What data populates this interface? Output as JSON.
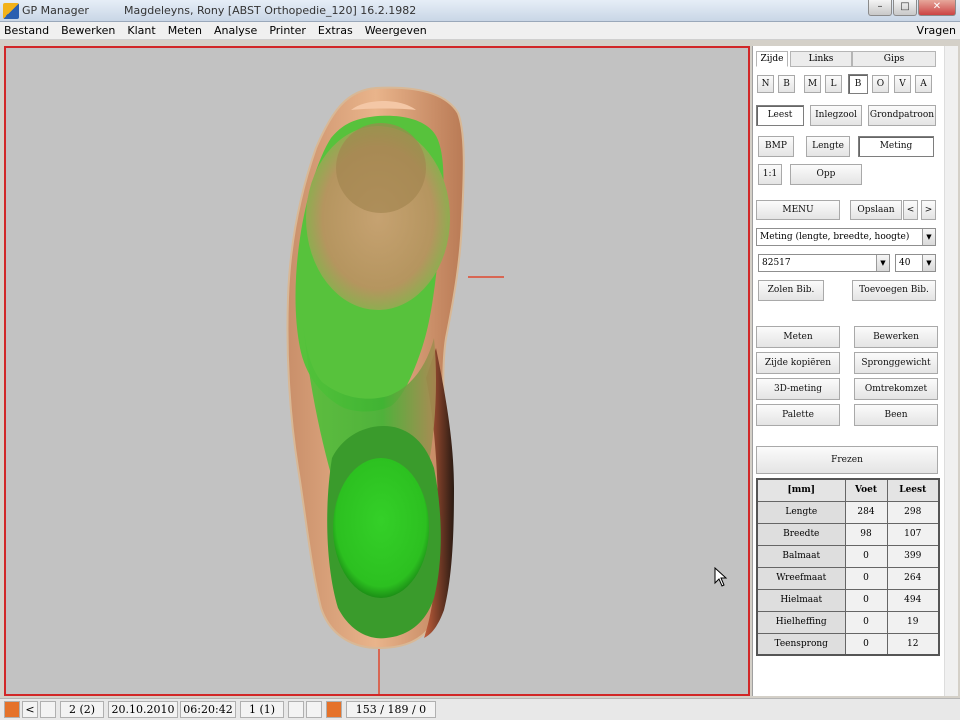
{
  "window": {
    "app_title": "GP Manager",
    "document_title": "Magdeleyns, Rony   [ABST Orthopedie_120]   16.2.1982",
    "buttons": [
      "–",
      "□",
      "✕"
    ]
  },
  "menu": {
    "items": [
      "Bestand",
      "Bewerken",
      "Klant",
      "Meten",
      "Analyse",
      "Printer",
      "Extras",
      "Weergeven"
    ],
    "help": "Vragen"
  },
  "panel": {
    "side_tabs": [
      "Zijde",
      "Links",
      "Gips"
    ],
    "view_buttons": [
      "N",
      "B",
      "M",
      "L",
      "B",
      "O",
      "V",
      "A"
    ],
    "active_view_index": 4,
    "mode_buttons": [
      "Leest",
      "Inlegzool",
      "Grondpatroon"
    ],
    "active_mode_index": 0,
    "tool_row1": [
      "BMP",
      "Lengte",
      "Meting"
    ],
    "tool_row2": [
      "1:1",
      "Opp"
    ],
    "menu_button": "MENU",
    "save_button": "Opslaan",
    "prev_arrow": "<",
    "next_arrow": ">",
    "measure_select": "Meting (lengte, breedte, hoogte)",
    "code_select": "82517",
    "size_select": "40",
    "zoom_buttons": [
      "Zolen Bib.",
      "Toevoegen Bib."
    ],
    "action_buttons": [
      "Meten",
      "Bewerken",
      "Zijde kopiëren",
      "Spronggewicht",
      "3D-meting",
      "Omtrekomzet",
      "Palette",
      "Been"
    ],
    "mill_button": "Frezen"
  },
  "measure_table": {
    "headers": [
      "[mm]",
      "Voet",
      "Leest"
    ],
    "rows": [
      [
        "Lengte",
        "284",
        "298"
      ],
      [
        "Breedte",
        "98",
        "107"
      ],
      [
        "Balmaat",
        "0",
        "399"
      ],
      [
        "Wreefmaat",
        "0",
        "264"
      ],
      [
        "Hielmaat",
        "0",
        "494"
      ],
      [
        "Hielheffing",
        "0",
        "19"
      ],
      [
        "Teensprong",
        "0",
        "12"
      ]
    ]
  },
  "status": {
    "page": "2 (2)",
    "date": "20.10.2010",
    "time": "06:20:42",
    "count": "1 (1)",
    "info": "153 / 189 / 0"
  },
  "colors": {
    "viewport_border": "#d12727",
    "viewport_bg": "#c2c2c2",
    "crosshair": "#e0472e"
  }
}
